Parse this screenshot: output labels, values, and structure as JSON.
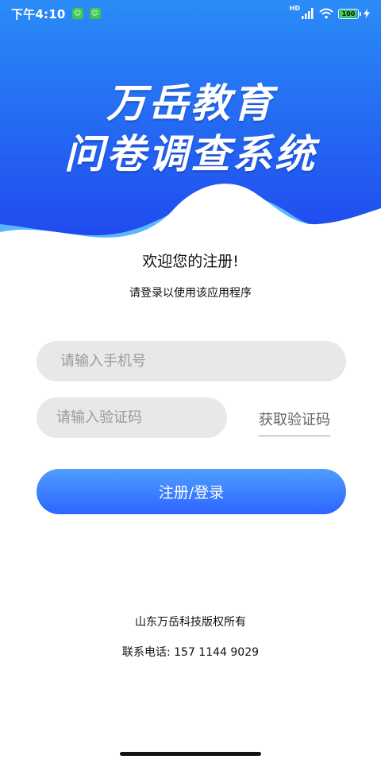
{
  "status_bar": {
    "time": "下午4:10",
    "hd": "HD",
    "battery": "100"
  },
  "header": {
    "title_line1": "万岳教育",
    "title_line2": "问卷调查系统",
    "colors": {
      "gradient_top": "#2a8cf7",
      "gradient_bottom": "#1f46ee",
      "wave_light": "#5ab6ff"
    }
  },
  "welcome": {
    "title": "欢迎您的注册!",
    "subtitle": "请登录以使用该应用程序"
  },
  "form": {
    "phone_placeholder": "请输入手机号",
    "code_placeholder": "请输入验证码",
    "get_code_label": "获取验证码",
    "submit_label": "注册/登录"
  },
  "footer": {
    "copyright": "山东万岳科技版权所有",
    "phone_label": "联系电话: 157 1144 9029"
  }
}
